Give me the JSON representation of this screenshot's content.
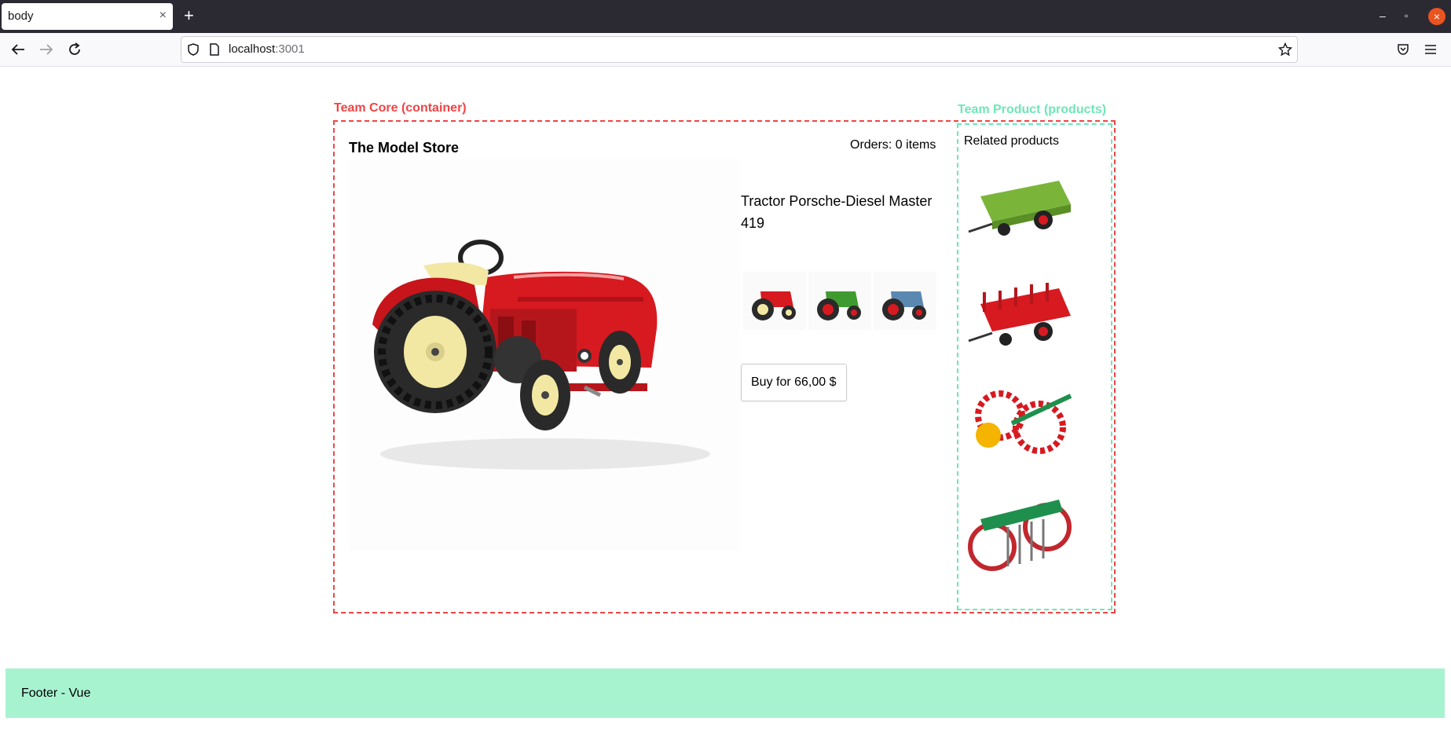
{
  "browser": {
    "tab_title": "body",
    "tab_close": "×",
    "new_tab": "+",
    "url_host": "localhost",
    "url_port": ":3001",
    "window_controls": {
      "minimize": "–",
      "restore": "▫",
      "close": "×"
    }
  },
  "core": {
    "label": "Team Core (container)",
    "store_title": "The Model Store",
    "orders": "Orders: 0 items",
    "product_name": "Tractor Porsche-Diesel Master 419",
    "buy_label": "Buy for 66,00 $",
    "variants": [
      "red tractor",
      "green tractor",
      "blue tractor"
    ]
  },
  "products": {
    "label": "Team Product (products)",
    "related_title": "Related products",
    "items": [
      "green trailer",
      "red trailer",
      "red seed drill",
      "green harrow"
    ]
  },
  "footer": {
    "text": "Footer - Vue"
  },
  "colors": {
    "core_border": "#f04444",
    "product_border": "#6ee7b7",
    "footer_bg": "#a7f3d0",
    "tractor_red": "#d71920",
    "wheel_cream": "#f3e8a3"
  },
  "icons": [
    "back-arrow-icon",
    "forward-arrow-icon",
    "reload-icon",
    "shield-icon",
    "page-icon",
    "star-icon",
    "pocket-icon",
    "menu-icon"
  ]
}
